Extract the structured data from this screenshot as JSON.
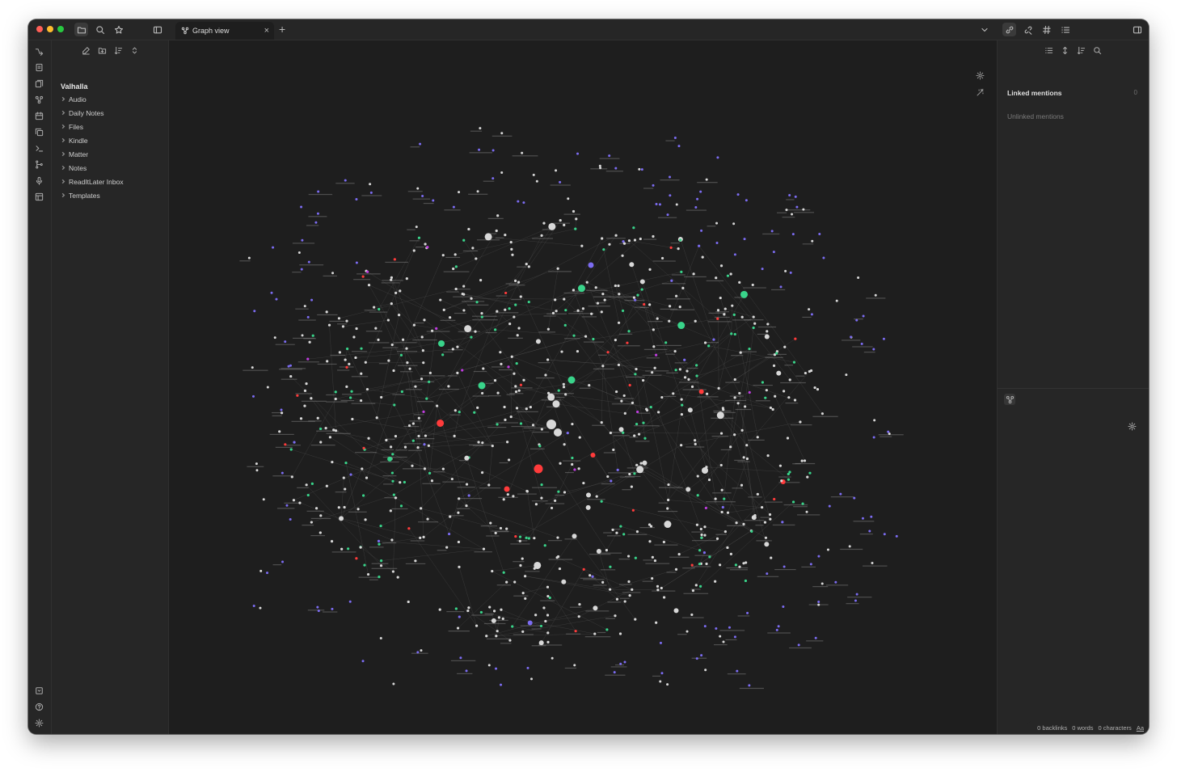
{
  "tab": {
    "title": "Graph view",
    "close": "×",
    "new": "+"
  },
  "sidebar": {
    "vault_name": "Valhalla",
    "folders": [
      "Audio",
      "Daily Notes",
      "Files",
      "Kindle",
      "Matter",
      "Notes",
      "ReadItLater Inbox",
      "Templates"
    ]
  },
  "backlinks": {
    "linked_label": "Linked mentions",
    "linked_count": "0",
    "unlinked_label": "Unlinked mentions"
  },
  "statusbar": {
    "backlinks": "0 backlinks",
    "words": "0 words",
    "characters": "0 characters",
    "toggle": "Aa"
  },
  "graph": {
    "node_colors": {
      "default": "#d8d8d8",
      "green": "#39d48a",
      "red": "#ff3b3b",
      "purple": "#7c6cf2",
      "magenta": "#c03de0"
    }
  },
  "icons": {
    "titlebar": [
      "folder-icon",
      "search-icon",
      "star-icon",
      "sidebar-toggle-icon"
    ],
    "ribbon": [
      "switcher-icon",
      "command-palette-icon",
      "templates-icon",
      "graph-icon",
      "calendar-icon",
      "copy-icon",
      "terminal-icon",
      "git-icon",
      "microphone-icon",
      "canvas-icon",
      "vault-switch-icon",
      "help-icon",
      "settings-icon"
    ]
  }
}
